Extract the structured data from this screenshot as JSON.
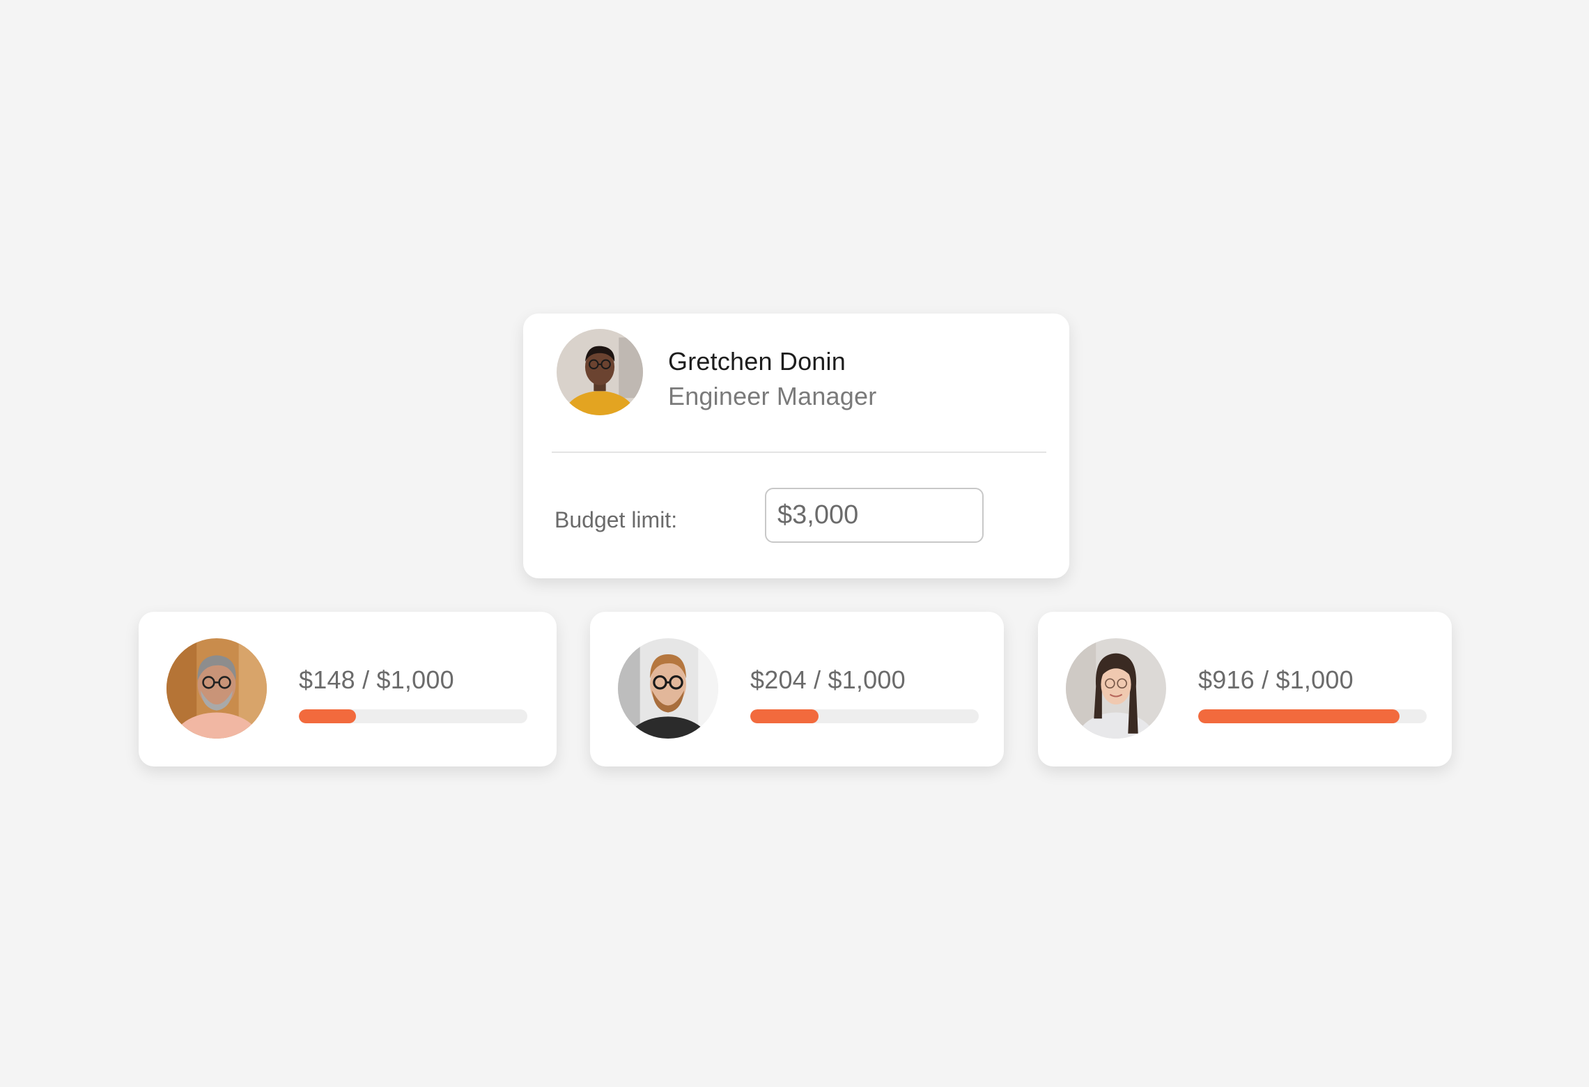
{
  "colors": {
    "accent": "#f26a3d",
    "track": "#eeeeee",
    "background": "#f4f4f4"
  },
  "manager": {
    "avatar_icon": "person-photo",
    "name": "Gretchen Donin",
    "role": "Engineer Manager",
    "budget_label": "Budget limit:",
    "budget_value": "$3,000"
  },
  "members": [
    {
      "avatar_icon": "person-photo",
      "spent_text": "$148 / $1,000",
      "progress": 0.25
    },
    {
      "avatar_icon": "person-photo",
      "spent_text": "$204 / $1,000",
      "progress": 0.3
    },
    {
      "avatar_icon": "person-photo",
      "spent_text": "$916 / $1,000",
      "progress": 0.88
    }
  ]
}
